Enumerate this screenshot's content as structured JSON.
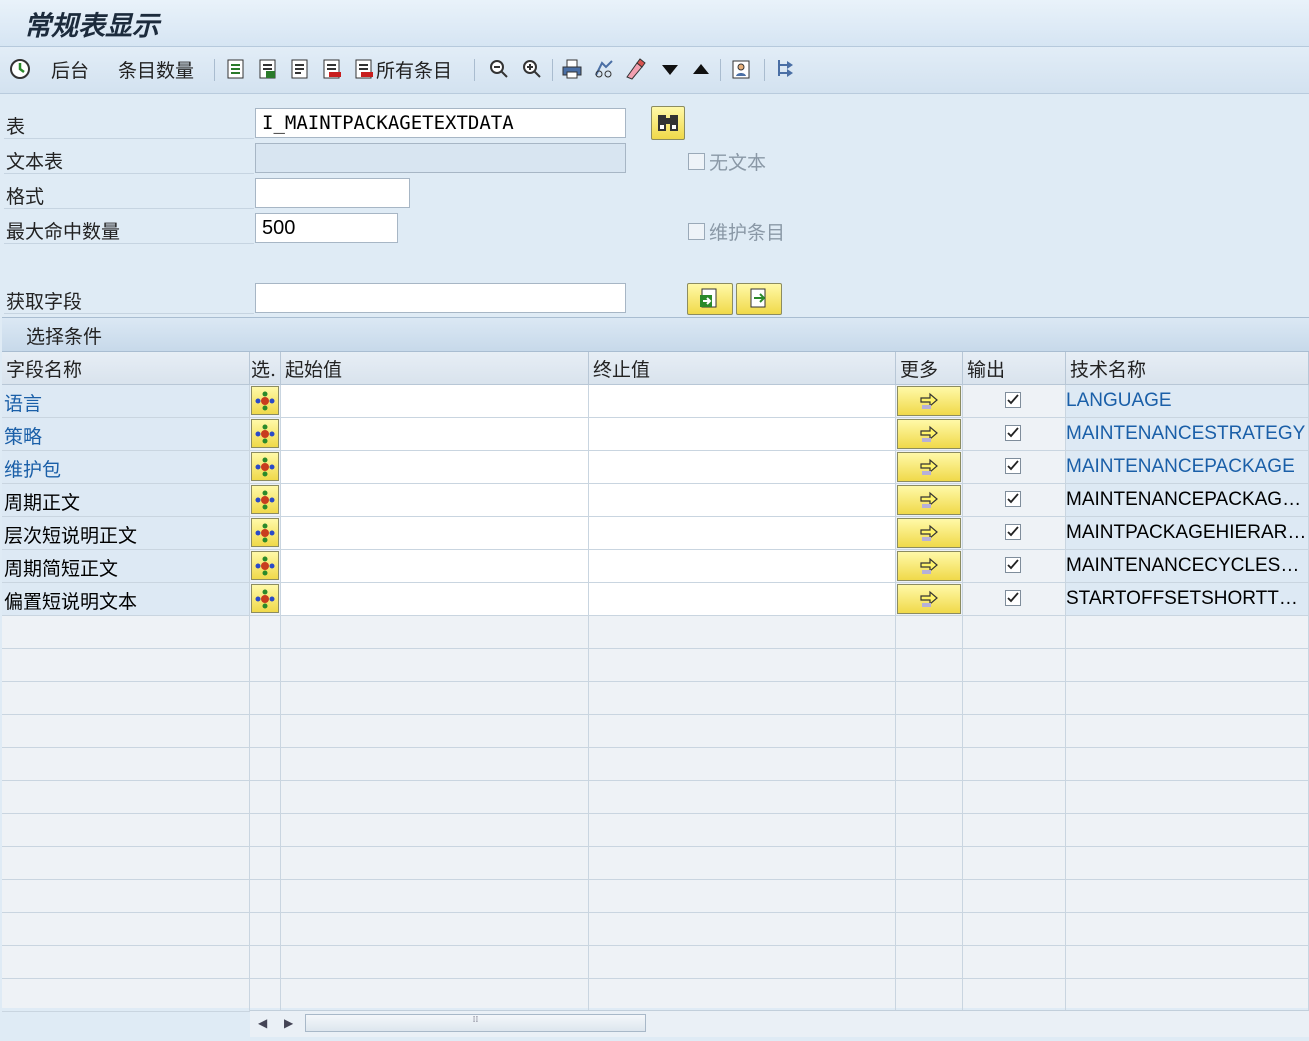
{
  "title": "常规表显示",
  "toolbar": {
    "background_label": "后台",
    "entry_count_label": "条目数量",
    "all_entries_label": "所有条目"
  },
  "form": {
    "table_label": "表",
    "table_value": "I_MAINTPACKAGETEXTDATA",
    "text_table_label": "文本表",
    "text_table_value": "",
    "format_label": "格式",
    "format_value": "",
    "max_hits_label": "最大命中数量",
    "max_hits_value": "500",
    "get_fields_label": "获取字段",
    "get_fields_value": "",
    "no_text_label": "无文本",
    "maintain_entries_label": "维护条目"
  },
  "selection": {
    "header": "选择条件",
    "columns": {
      "field_name": "字段名称",
      "sel": "选.",
      "from": "起始值",
      "to": "终止值",
      "more": "更多",
      "output": "输出",
      "tech_name": "技术名称"
    },
    "rows": [
      {
        "name": "语言",
        "tech": "LANGUAGE",
        "output": true,
        "key": true
      },
      {
        "name": "策略",
        "tech": "MAINTENANCESTRATEGY",
        "output": true,
        "key": true
      },
      {
        "name": "维护包",
        "tech": "MAINTENANCEPACKAGE",
        "output": true,
        "key": true
      },
      {
        "name": "周期正文",
        "tech": "MAINTENANCEPACKAGETE...",
        "output": true,
        "key": false
      },
      {
        "name": "层次短说明正文",
        "tech": "MAINTPACKAGEHIERARCH...",
        "output": true,
        "key": false
      },
      {
        "name": "周期简短正文",
        "tech": "MAINTENANCECYCLESHOR...",
        "output": true,
        "key": false
      },
      {
        "name": "偏置短说明文本",
        "tech": "STARTOFFSETSHORTTEXT",
        "output": true,
        "key": false
      }
    ]
  },
  "colors": {
    "key_field": "#1a5fa8",
    "button_yellow": "#f0d94a",
    "background": "#dfebf5"
  }
}
